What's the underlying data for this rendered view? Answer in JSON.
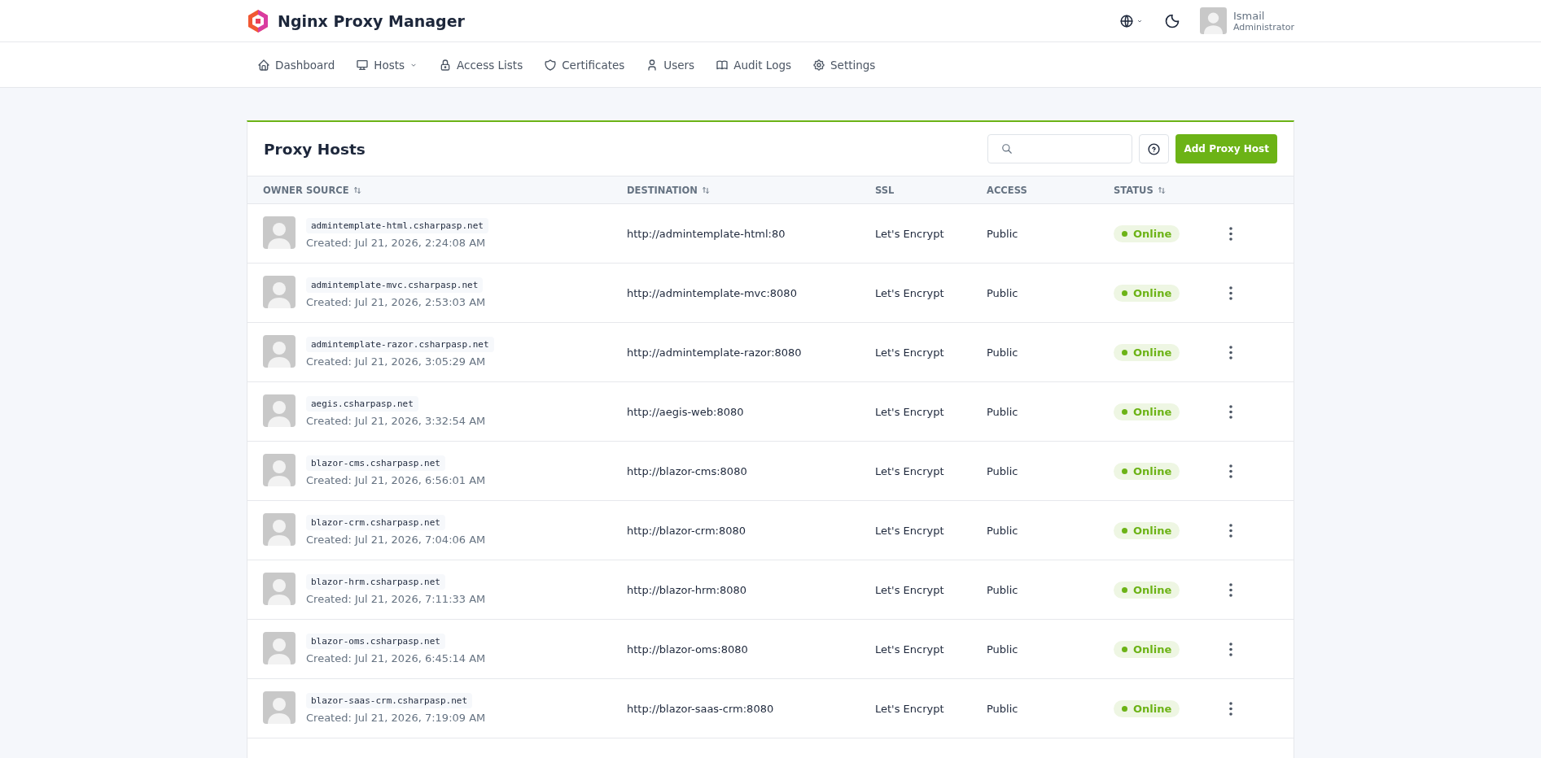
{
  "brand": {
    "title": "Nginx Proxy Manager"
  },
  "user": {
    "name": "Ismail",
    "role": "Administrator"
  },
  "nav": [
    {
      "label": "Dashboard",
      "dropdown": false
    },
    {
      "label": "Hosts",
      "dropdown": true
    },
    {
      "label": "Access Lists",
      "dropdown": false
    },
    {
      "label": "Certificates",
      "dropdown": false
    },
    {
      "label": "Users",
      "dropdown": false
    },
    {
      "label": "Audit Logs",
      "dropdown": false
    },
    {
      "label": "Settings",
      "dropdown": false
    }
  ],
  "card": {
    "title": "Proxy Hosts",
    "add_button": "Add Proxy Host"
  },
  "table": {
    "columns": [
      {
        "label": "OWNER",
        "sortable": false
      },
      {
        "label": "SOURCE",
        "sortable": true
      },
      {
        "label": "DESTINATION",
        "sortable": true
      },
      {
        "label": "SSL",
        "sortable": false
      },
      {
        "label": "ACCESS",
        "sortable": false
      },
      {
        "label": "STATUS",
        "sortable": true
      }
    ],
    "rows": [
      {
        "source": "admintemplate-html.csharpasp.net",
        "created": "Created: Jul 21, 2026, 2:24:08 AM",
        "destination": "http://admintemplate-html:80",
        "ssl": "Let's Encrypt",
        "access": "Public",
        "status": "Online",
        "online": true
      },
      {
        "source": "admintemplate-mvc.csharpasp.net",
        "created": "Created: Jul 21, 2026, 2:53:03 AM",
        "destination": "http://admintemplate-mvc:8080",
        "ssl": "Let's Encrypt",
        "access": "Public",
        "status": "Online",
        "online": true
      },
      {
        "source": "admintemplate-razor.csharpasp.net",
        "created": "Created: Jul 21, 2026, 3:05:29 AM",
        "destination": "http://admintemplate-razor:8080",
        "ssl": "Let's Encrypt",
        "access": "Public",
        "status": "Online",
        "online": true
      },
      {
        "source": "aegis.csharpasp.net",
        "created": "Created: Jul 21, 2026, 3:32:54 AM",
        "destination": "http://aegis-web:8080",
        "ssl": "Let's Encrypt",
        "access": "Public",
        "status": "Online",
        "online": true
      },
      {
        "source": "blazor-cms.csharpasp.net",
        "created": "Created: Jul 21, 2026, 6:56:01 AM",
        "destination": "http://blazor-cms:8080",
        "ssl": "Let's Encrypt",
        "access": "Public",
        "status": "Online",
        "online": true
      },
      {
        "source": "blazor-crm.csharpasp.net",
        "created": "Created: Jul 21, 2026, 7:04:06 AM",
        "destination": "http://blazor-crm:8080",
        "ssl": "Let's Encrypt",
        "access": "Public",
        "status": "Online",
        "online": true
      },
      {
        "source": "blazor-hrm.csharpasp.net",
        "created": "Created: Jul 21, 2026, 7:11:33 AM",
        "destination": "http://blazor-hrm:8080",
        "ssl": "Let's Encrypt",
        "access": "Public",
        "status": "Online",
        "online": true
      },
      {
        "source": "blazor-oms.csharpasp.net",
        "created": "Created: Jul 21, 2026, 6:45:14 AM",
        "destination": "http://blazor-oms:8080",
        "ssl": "Let's Encrypt",
        "access": "Public",
        "status": "Online",
        "online": true
      },
      {
        "source": "blazor-saas-crm.csharpasp.net",
        "created": "Created: Jul 21, 2026, 7:19:09 AM",
        "destination": "http://blazor-saas-crm:8080",
        "ssl": "Let's Encrypt",
        "access": "Public",
        "status": "Online",
        "online": true
      }
    ]
  }
}
